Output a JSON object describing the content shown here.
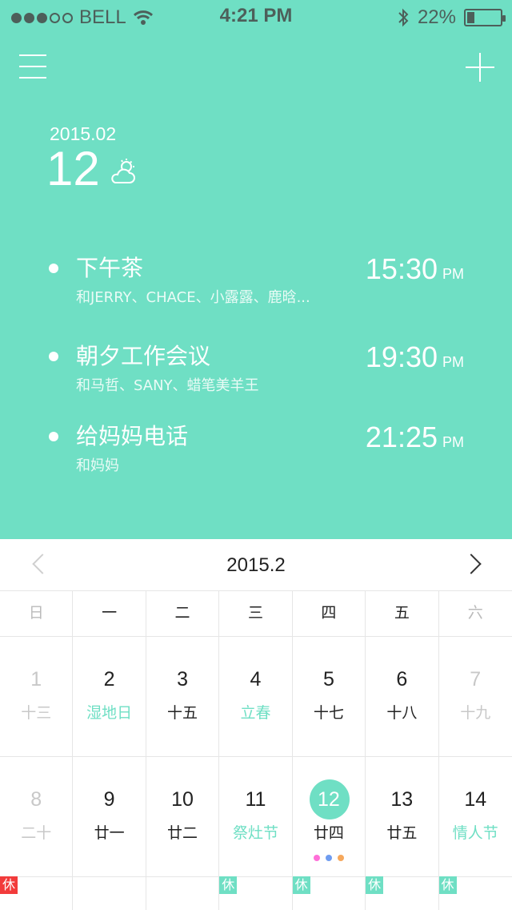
{
  "status_bar": {
    "carrier": "BELL",
    "time": "4:21 PM",
    "battery": "22%",
    "battery_level": 0.22,
    "signal_filled": 3,
    "signal_total": 5
  },
  "header": {
    "year_month": "2015.02",
    "day": "12",
    "weather_icon": "partly-cloudy-icon"
  },
  "events": [
    {
      "title": "下午茶",
      "subtitle": "和JERRY、CHACE、小露露、鹿晗...",
      "time": "15:30",
      "ampm": "PM"
    },
    {
      "title": "朝夕工作会议",
      "subtitle": "和马哲、SANY、蜡笔美羊王",
      "time": "19:30",
      "ampm": "PM"
    },
    {
      "title": "给妈妈电话",
      "subtitle": "和妈妈",
      "time": "21:25",
      "ampm": "PM"
    }
  ],
  "calendar": {
    "title": "2015.2",
    "weekdays": [
      "日",
      "一",
      "二",
      "三",
      "四",
      "五",
      "六"
    ],
    "weeks": [
      [
        {
          "num": "1",
          "lunar": "十三",
          "muted": true,
          "green": false
        },
        {
          "num": "2",
          "lunar": "湿地日",
          "muted": false,
          "green": true
        },
        {
          "num": "3",
          "lunar": "十五",
          "muted": false,
          "green": false
        },
        {
          "num": "4",
          "lunar": "立春",
          "muted": false,
          "green": true
        },
        {
          "num": "5",
          "lunar": "十七",
          "muted": false,
          "green": false
        },
        {
          "num": "6",
          "lunar": "十八",
          "muted": false,
          "green": false
        },
        {
          "num": "7",
          "lunar": "十九",
          "muted": true,
          "green": false
        }
      ],
      [
        {
          "num": "8",
          "lunar": "二十",
          "muted": true,
          "green": false
        },
        {
          "num": "9",
          "lunar": "廿一",
          "muted": false,
          "green": false
        },
        {
          "num": "10",
          "lunar": "廿二",
          "muted": false,
          "green": false
        },
        {
          "num": "11",
          "lunar": "祭灶节",
          "muted": false,
          "green": true
        },
        {
          "num": "12",
          "lunar": "廿四",
          "muted": false,
          "green": false,
          "today": true
        },
        {
          "num": "13",
          "lunar": "廿五",
          "muted": false,
          "green": false
        },
        {
          "num": "14",
          "lunar": "情人节",
          "muted": false,
          "green": true
        }
      ]
    ],
    "today_dots": [
      "#ff6fd8",
      "#6f9cf0",
      "#f6a85c"
    ],
    "rest_tags": [
      {
        "text": "休",
        "color": "red"
      },
      {
        "text": "",
        "color": ""
      },
      {
        "text": "",
        "color": ""
      },
      {
        "text": "休",
        "color": "green"
      },
      {
        "text": "休",
        "color": "green"
      },
      {
        "text": "休",
        "color": "green"
      },
      {
        "text": "休",
        "color": "green"
      }
    ]
  },
  "colors": {
    "accent": "#6fdfc4",
    "rest_red": "#f23b3b"
  }
}
